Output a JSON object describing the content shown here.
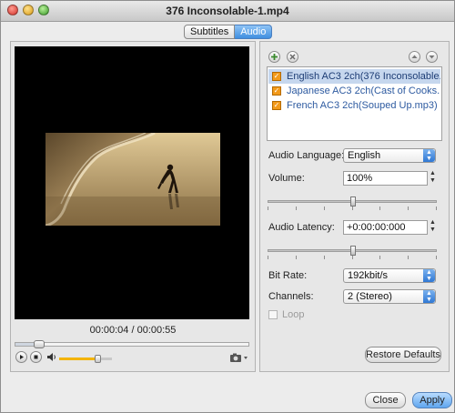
{
  "window": {
    "title": "376 Inconsolable-1.mp4"
  },
  "tabs": [
    {
      "label": "Subtitles",
      "active": false
    },
    {
      "label": "Audio",
      "active": true
    }
  ],
  "player": {
    "time_current": "00:00:04",
    "time_separator": "/",
    "time_total": "00:00:55",
    "seek_progress": 0.08,
    "volume_level": 0.72
  },
  "audio": {
    "add_icon": "plus-icon",
    "remove_icon": "x-icon",
    "up_icon": "arrow-up-icon",
    "down_icon": "arrow-down-icon",
    "tracks": [
      {
        "label": "English AC3 2ch(376 Inconsolable....",
        "checked": true,
        "selected": true
      },
      {
        "label": "Japanese AC3 2ch(Cast of Cooks....",
        "checked": true,
        "selected": false
      },
      {
        "label": "French AC3 2ch(Souped Up.mp3)",
        "checked": true,
        "selected": false
      }
    ],
    "language_label": "Audio Language:",
    "language_value": "English",
    "volume_label": "Volume:",
    "volume_value": "100%",
    "volume_slider": 0.5,
    "latency_label": "Audio Latency:",
    "latency_value": "+0:00:00:000",
    "latency_slider": 0.5,
    "bitrate_label": "Bit Rate:",
    "bitrate_value": "192kbit/s",
    "channels_label": "Channels:",
    "channels_value": "2 (Stereo)",
    "loop_label": "Loop",
    "restore_label": "Restore Defaults"
  },
  "footer": {
    "close_label": "Close",
    "apply_label": "Apply"
  },
  "colors": {
    "accent": "#3f8fe0",
    "track_text": "#2d5aa0",
    "checkbox": "#f39a1a",
    "volume_fill": "#f3b400"
  }
}
